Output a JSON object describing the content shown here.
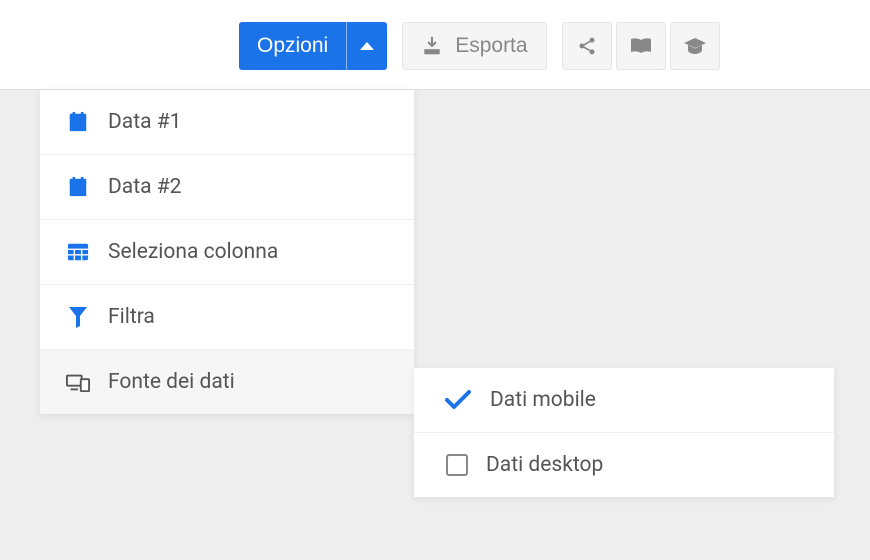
{
  "toolbar": {
    "options_label": "Opzioni",
    "export_label": "Esporta"
  },
  "dropdown": {
    "items": [
      {
        "label": "Data #1",
        "icon": "calendar"
      },
      {
        "label": "Data #2",
        "icon": "calendar"
      },
      {
        "label": "Seleziona colonna",
        "icon": "table"
      },
      {
        "label": "Filtra",
        "icon": "funnel"
      },
      {
        "label": "Fonte dei dati",
        "icon": "devices"
      }
    ]
  },
  "submenu": {
    "items": [
      {
        "label": "Dati mobile",
        "checked": true
      },
      {
        "label": "Dati desktop",
        "checked": false
      }
    ]
  },
  "colors": {
    "primary": "#1a73e8",
    "muted": "#888888"
  }
}
